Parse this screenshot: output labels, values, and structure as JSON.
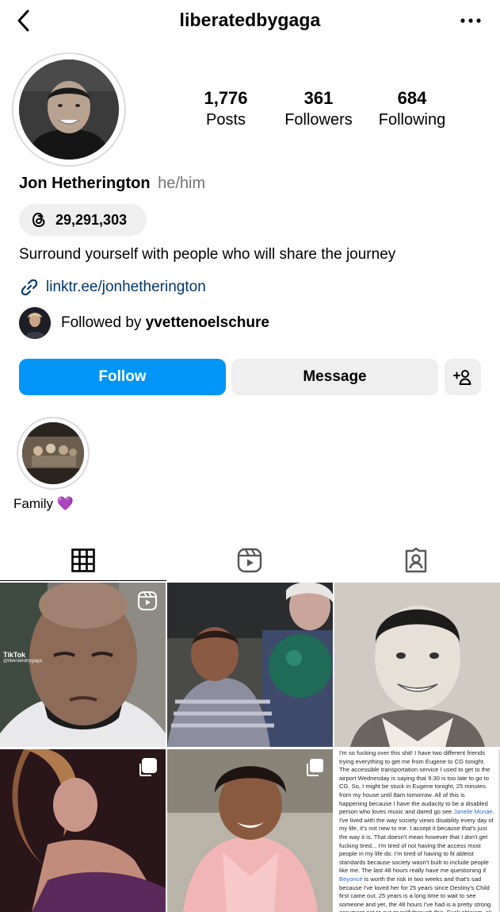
{
  "header": {
    "username": "liberatedbygaga",
    "back_icon": "chevron-left-icon",
    "more_icon": "more-horizontal-icon"
  },
  "profile": {
    "stats": {
      "posts": {
        "value": "1,776",
        "label": "Posts"
      },
      "followers": {
        "value": "361",
        "label": "Followers"
      },
      "following": {
        "value": "684",
        "label": "Following"
      }
    },
    "name": "Jon Hetherington",
    "pronouns": "he/him",
    "threads_count": "29,291,303",
    "bio": "Surround yourself with people who will share the journey",
    "link": "linktr.ee/jonhetherington",
    "followed_by_prefix": "Followed by ",
    "followed_by_user": "yvettenoelschure"
  },
  "actions": {
    "follow": "Follow",
    "message": "Message"
  },
  "highlights": [
    {
      "label": "Family",
      "emoji": "💜"
    }
  ],
  "tabs": [
    {
      "name": "posts",
      "icon": "grid-icon",
      "active": true
    },
    {
      "name": "reels",
      "icon": "reels-icon",
      "active": false
    },
    {
      "name": "tagged",
      "icon": "tagged-icon",
      "active": false
    }
  ],
  "grid": {
    "tiktok_label": "TikTok",
    "tiktok_handle": "@liberatedbygaga",
    "note_text_1": "I'm so fucking over this shit! I have two different friends trying everything to get me from Eugene to CG tonight. The accessible transportation service I used to get to the airport Wednesday is saying that 9:30 is too late to go to CG. So, I might be stuck in Eugene tonight, 25 minutes from my house until 8am tomorrow. All of this is happening because I have the audacity to be a disabled person who loves music and dared go see ",
    "note_link_1": "Janelle Monáe",
    "note_text_2": ". I've lived with the way society views disability every day of my life, it's not new to me. I accept it because that's just the way it is. That doesn't mean however that I don't get fucking tired... I'm tired of not having the access most people in my life do. I'm tired of having to fit ableist standards because society wasn't built to include people like me. The last 48 hours really have me questioning if ",
    "note_link_2": "Beyoncé",
    "note_text_3": " is worth the risk in two weeks and that's sad because I've loved her for 25 years since Destiny's Child first came out. 25 years is a long time to wait to see someone and yet, the 48 hours I've had is a pretty strong argument not to put myself through this. Fuck ableism, ok ya!"
  },
  "colors": {
    "follow_button": "#0095f6",
    "secondary_button": "#efefef",
    "link": "#00376b",
    "muted_text": "#737373"
  }
}
